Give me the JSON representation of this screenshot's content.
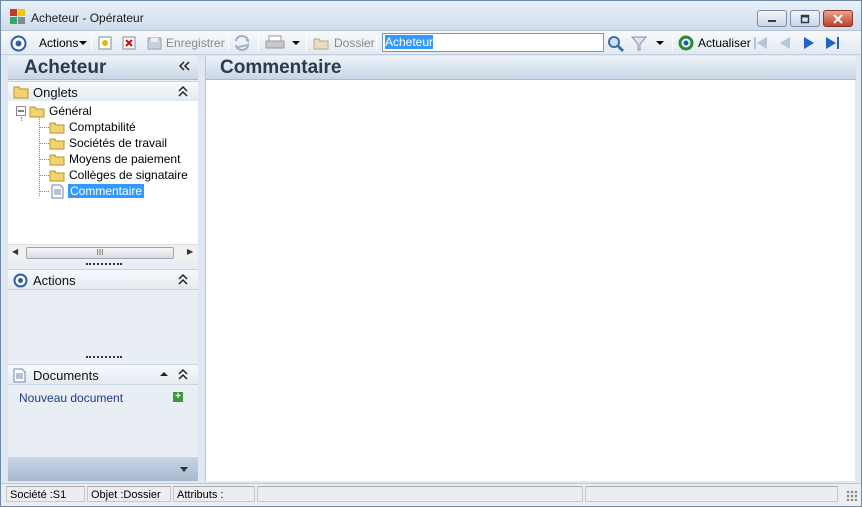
{
  "window": {
    "title": "Acheteur -  Opérateur",
    "colors": {
      "accent": "#3399ff",
      "title_bg": "#dfe8f2",
      "close": "#c0412a"
    }
  },
  "toolbar": {
    "actions_label": "Actions",
    "save_label": "Enregistrer",
    "folder_label": "Dossier",
    "search_value": "Acheteur",
    "refresh_label": "Actualiser"
  },
  "left_panel": {
    "title": "Acheteur",
    "onglets": {
      "title": "Onglets",
      "root": "Général",
      "children": [
        "Comptabilité",
        "Sociétés de travail",
        "Moyens de paiement",
        "Collèges de signataire",
        "Commentaire"
      ],
      "selected": "Commentaire",
      "scroll_glyph": "III"
    },
    "actions_section": {
      "title": "Actions"
    },
    "documents_section": {
      "title": "Documents",
      "new_document": "Nouveau document"
    }
  },
  "main": {
    "title": "Commentaire"
  },
  "status": {
    "societe": "Société :S1",
    "objet": "Objet :Dossier",
    "attributs": "Attributs :"
  }
}
